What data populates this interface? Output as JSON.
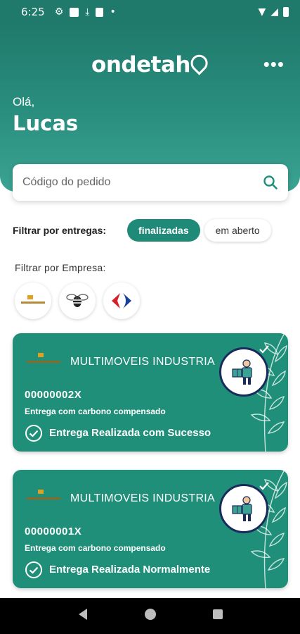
{
  "status_bar": {
    "time": "6:25"
  },
  "header": {
    "logo_text": "ondetah",
    "greeting": "Olá,",
    "username": "Lucas"
  },
  "search": {
    "placeholder": "Código do pedido"
  },
  "filters": {
    "delivery_label": "Filtrar por entregas:",
    "chips": [
      {
        "label": "finalizadas",
        "active": true
      },
      {
        "label": "em aberto",
        "active": false
      }
    ],
    "company_label": "Filtrar por Empresa:"
  },
  "companies": [
    {
      "icon": "multimoveis-logo"
    },
    {
      "icon": "bee-logo"
    },
    {
      "icon": "carrefour-logo"
    }
  ],
  "orders": [
    {
      "company": "MULTIMOVEIS INDUSTRIA",
      "order_id": "00000002X",
      "note": "Entrega com carbono compensado",
      "status": "Entrega Realizada com Sucesso"
    },
    {
      "company": "MULTIMOVEIS INDUSTRIA",
      "order_id": "00000001X",
      "note": "Entrega com carbono compensado",
      "status": "Entrega Realizada Normalmente"
    }
  ],
  "colors": {
    "primary": "#1f8f79",
    "header_dark": "#1f7a6c",
    "navy": "#1a2a5a"
  }
}
